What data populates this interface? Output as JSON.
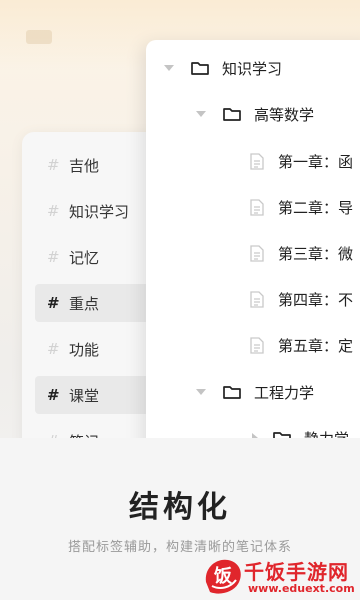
{
  "tags_panel": {
    "items": [
      {
        "hash": "#",
        "label": "吉他",
        "active": false
      },
      {
        "hash": "#",
        "label": "知识学习",
        "active": false
      },
      {
        "hash": "#",
        "label": "记忆",
        "active": false
      },
      {
        "hash": "#",
        "label": "重点",
        "active": true
      },
      {
        "hash": "#",
        "label": "功能",
        "active": false
      },
      {
        "hash": "#",
        "label": "课堂",
        "active": true
      },
      {
        "hash": "#",
        "label": "笔记",
        "active": false
      }
    ]
  },
  "tree": {
    "root": {
      "label": "知识学习"
    },
    "folder1": {
      "label": "高等数学"
    },
    "docs": [
      {
        "label": "第一章：函"
      },
      {
        "label": "第二章：导"
      },
      {
        "label": "第三章：微"
      },
      {
        "label": "第四章：不"
      },
      {
        "label": "第五章：定"
      }
    ],
    "folder2": {
      "label": "工程力学"
    },
    "subfolder": {
      "label": "静力学"
    }
  },
  "feature": {
    "title": "结构化",
    "subtitle": "搭配标签辅助，构建清晰的笔记体系"
  },
  "watermark": {
    "logo_char": "饭",
    "title": "千饭手游网",
    "url": "www.eduext.com"
  },
  "colors": {
    "accent_red": "#e0262c",
    "text_dark": "#222222",
    "text_muted": "#9a9a9a"
  }
}
